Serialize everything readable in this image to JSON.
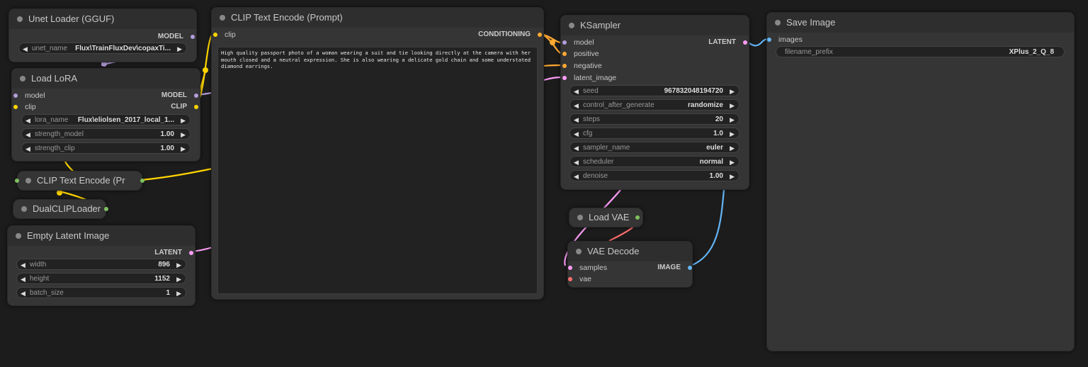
{
  "nodes": {
    "unet_loader": {
      "title": "Unet Loader (GGUF)",
      "output": "MODEL",
      "widgets": [
        {
          "label": "unet_name",
          "value": "Flux\\TrainFluxDev\\copaxTi..."
        }
      ]
    },
    "load_lora": {
      "title": "Load LoRA",
      "inputs": [
        "model",
        "clip"
      ],
      "outputs": [
        "MODEL",
        "CLIP"
      ],
      "widgets": [
        {
          "label": "lora_name",
          "value": "Flux\\eliolsen_2017_local_1..."
        },
        {
          "label": "strength_model",
          "value": "1.00"
        },
        {
          "label": "strength_clip",
          "value": "1.00"
        }
      ]
    },
    "clip_text_encode_collapsed": {
      "title": "CLIP Text Encode (Pr"
    },
    "dual_clip_loader": {
      "title": "DualCLIPLoader"
    },
    "empty_latent": {
      "title": "Empty Latent Image",
      "output": "LATENT",
      "widgets": [
        {
          "label": "width",
          "value": "896"
        },
        {
          "label": "height",
          "value": "1152"
        },
        {
          "label": "batch_size",
          "value": "1"
        }
      ]
    },
    "clip_text_encode": {
      "title": "CLIP Text Encode (Prompt)",
      "input": "clip",
      "output": "CONDITIONING",
      "prompt": "High quality passport photo of a woman wearing a suit and tie looking directly at the camera with her mouth closed and a neutral expression. She is also wearing a delicate gold chain and some understated diamond earrings."
    },
    "ksampler": {
      "title": "KSampler",
      "inputs": [
        "model",
        "positive",
        "negative",
        "latent_image"
      ],
      "output": "LATENT",
      "widgets": [
        {
          "label": "seed",
          "value": "967832048194720"
        },
        {
          "label": "control_after_generate",
          "value": "randomize"
        },
        {
          "label": "steps",
          "value": "20"
        },
        {
          "label": "cfg",
          "value": "1.0"
        },
        {
          "label": "sampler_name",
          "value": "euler"
        },
        {
          "label": "scheduler",
          "value": "normal"
        },
        {
          "label": "denoise",
          "value": "1.00"
        }
      ]
    },
    "load_vae": {
      "title": "Load VAE"
    },
    "vae_decode": {
      "title": "VAE Decode",
      "inputs": [
        "samples",
        "vae"
      ],
      "output": "IMAGE"
    },
    "save_image": {
      "title": "Save Image",
      "input": "images",
      "widgets": [
        {
          "label": "filename_prefix",
          "value": "XPlus_2_Q_8"
        }
      ]
    }
  },
  "colors": {
    "canvas": "#1c1c1c",
    "node": "#353535",
    "model": "#b39ddb",
    "clip": "#ffd500",
    "conditioning": "#ffa931",
    "latent": "#ff9cf9",
    "image": "#64b5f6",
    "vae": "#ff6e6e"
  }
}
